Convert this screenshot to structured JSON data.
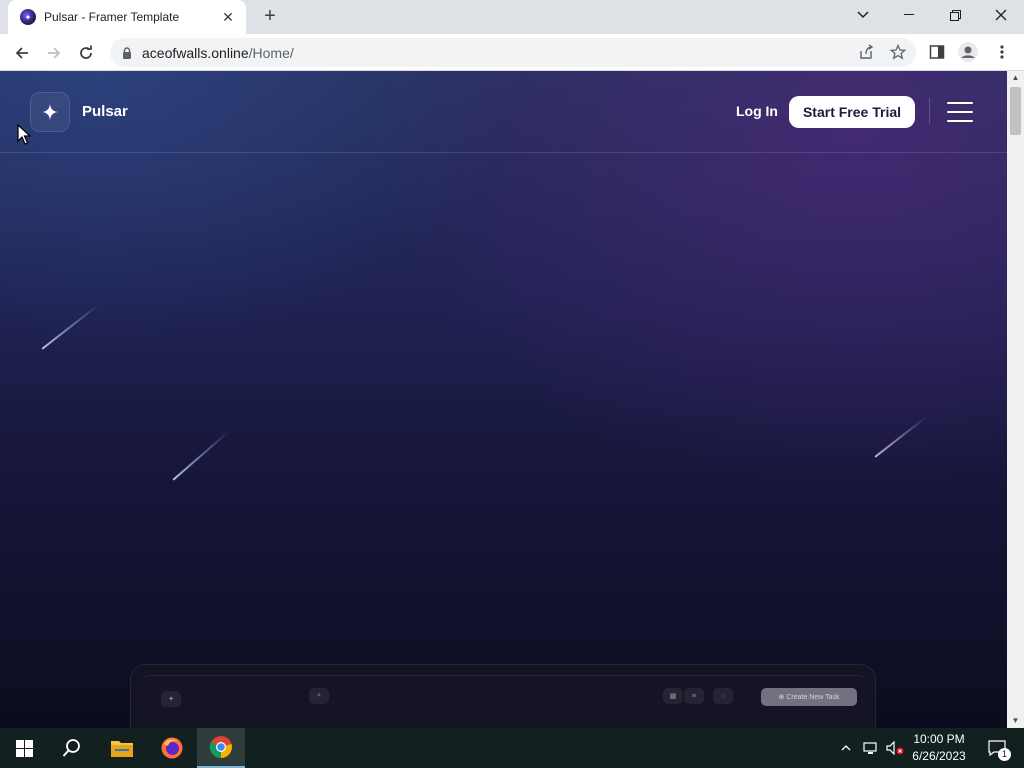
{
  "browser": {
    "tab_title": "Pulsar - Framer Template",
    "url_host": "aceofwalls.online",
    "url_path": "/Home/"
  },
  "site": {
    "logo_text": "Pulsar",
    "login_label": "Log In",
    "cta_label": "Start Free Trial"
  },
  "dashboard_preview": {
    "button_label": "Create New Task"
  },
  "taskbar": {
    "time": "10:00 PM",
    "date": "6/26/2023",
    "notification_count": "1"
  }
}
